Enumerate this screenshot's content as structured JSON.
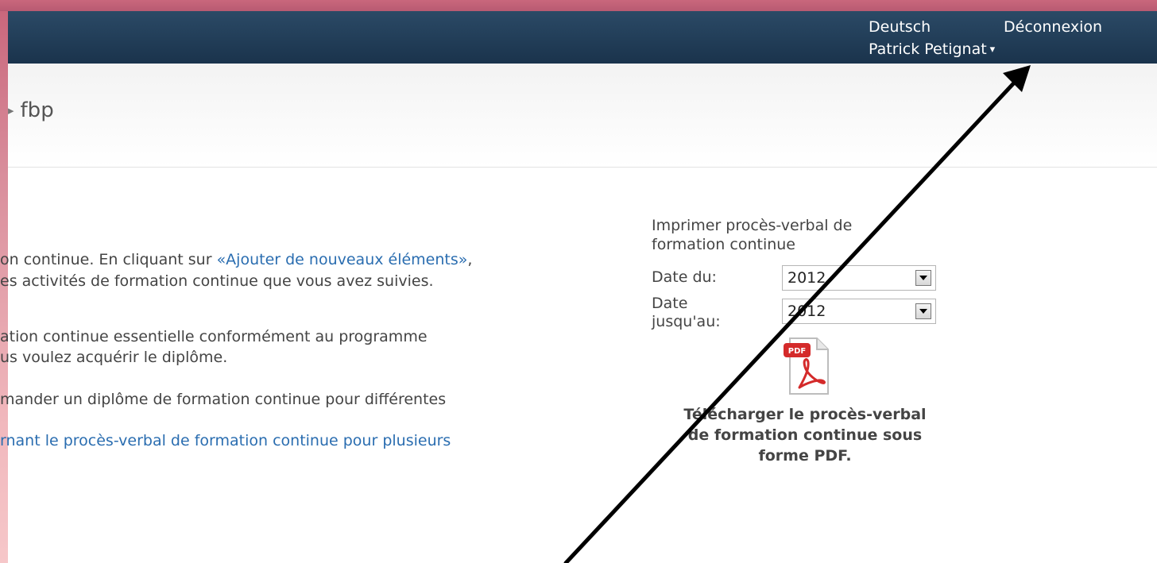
{
  "header": {
    "language_link": "Deutsch",
    "logout_link": "Déconnexion",
    "user_name": "Patrick Petignat",
    "user_caret": "▾"
  },
  "breadcrumb": {
    "separator": "▸",
    "current": "fbp"
  },
  "content": {
    "p1_line1_before": "on continue. En cliquant sur ",
    "p1_link": "«Ajouter de nouveaux éléments»",
    "p1_line1_after": ",",
    "p1_line2": "es activités de formation continue que vous avez suivies.",
    "p2_line1": "ation continue essentielle conformément au programme",
    "p2_line2": "us voulez acquérir le diplôme.",
    "p3_line1": "mander un diplôme de formation continue pour différentes",
    "p4_link": "rnant le procès-verbal de formation continue pour plusieurs"
  },
  "print_panel": {
    "title_line1": "Imprimer procès-verbal de",
    "title_line2": "formation continue",
    "date_from_label": "Date du:",
    "date_from_value": "2012",
    "date_to_label_line1": "Date",
    "date_to_label_line2": "jusqu'au:",
    "date_to_value": "2012",
    "pdf_badge": "PDF",
    "download_line1": "Télécharger le procès-verbal",
    "download_line2": "de formation continue sous",
    "download_line3": "forme PDF."
  },
  "colors": {
    "topbar": "#1f3a55",
    "frame": "#c9677c",
    "link": "#2a6db0",
    "pdf_red": "#d42a2a"
  }
}
